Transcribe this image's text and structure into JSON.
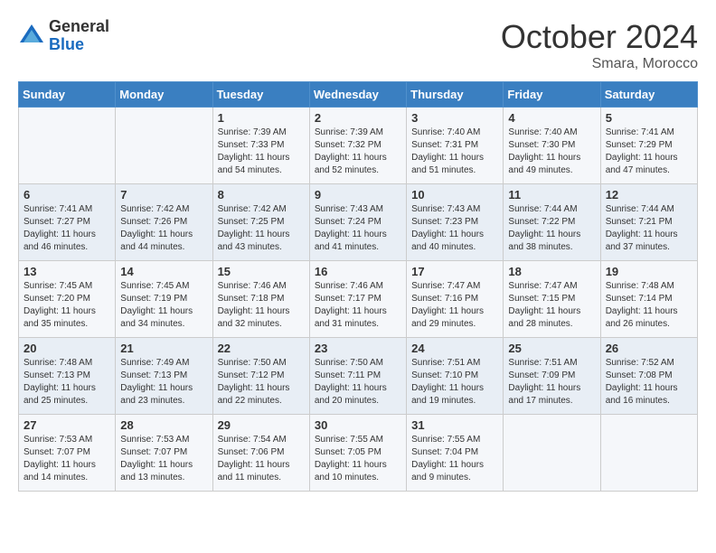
{
  "header": {
    "logo_line1": "General",
    "logo_line2": "Blue",
    "month_title": "October 2024",
    "location": "Smara, Morocco"
  },
  "days_of_week": [
    "Sunday",
    "Monday",
    "Tuesday",
    "Wednesday",
    "Thursday",
    "Friday",
    "Saturday"
  ],
  "weeks": [
    [
      {
        "day": "",
        "info": ""
      },
      {
        "day": "",
        "info": ""
      },
      {
        "day": "1",
        "info": "Sunrise: 7:39 AM\nSunset: 7:33 PM\nDaylight: 11 hours\nand 54 minutes."
      },
      {
        "day": "2",
        "info": "Sunrise: 7:39 AM\nSunset: 7:32 PM\nDaylight: 11 hours\nand 52 minutes."
      },
      {
        "day": "3",
        "info": "Sunrise: 7:40 AM\nSunset: 7:31 PM\nDaylight: 11 hours\nand 51 minutes."
      },
      {
        "day": "4",
        "info": "Sunrise: 7:40 AM\nSunset: 7:30 PM\nDaylight: 11 hours\nand 49 minutes."
      },
      {
        "day": "5",
        "info": "Sunrise: 7:41 AM\nSunset: 7:29 PM\nDaylight: 11 hours\nand 47 minutes."
      }
    ],
    [
      {
        "day": "6",
        "info": "Sunrise: 7:41 AM\nSunset: 7:27 PM\nDaylight: 11 hours\nand 46 minutes."
      },
      {
        "day": "7",
        "info": "Sunrise: 7:42 AM\nSunset: 7:26 PM\nDaylight: 11 hours\nand 44 minutes."
      },
      {
        "day": "8",
        "info": "Sunrise: 7:42 AM\nSunset: 7:25 PM\nDaylight: 11 hours\nand 43 minutes."
      },
      {
        "day": "9",
        "info": "Sunrise: 7:43 AM\nSunset: 7:24 PM\nDaylight: 11 hours\nand 41 minutes."
      },
      {
        "day": "10",
        "info": "Sunrise: 7:43 AM\nSunset: 7:23 PM\nDaylight: 11 hours\nand 40 minutes."
      },
      {
        "day": "11",
        "info": "Sunrise: 7:44 AM\nSunset: 7:22 PM\nDaylight: 11 hours\nand 38 minutes."
      },
      {
        "day": "12",
        "info": "Sunrise: 7:44 AM\nSunset: 7:21 PM\nDaylight: 11 hours\nand 37 minutes."
      }
    ],
    [
      {
        "day": "13",
        "info": "Sunrise: 7:45 AM\nSunset: 7:20 PM\nDaylight: 11 hours\nand 35 minutes."
      },
      {
        "day": "14",
        "info": "Sunrise: 7:45 AM\nSunset: 7:19 PM\nDaylight: 11 hours\nand 34 minutes."
      },
      {
        "day": "15",
        "info": "Sunrise: 7:46 AM\nSunset: 7:18 PM\nDaylight: 11 hours\nand 32 minutes."
      },
      {
        "day": "16",
        "info": "Sunrise: 7:46 AM\nSunset: 7:17 PM\nDaylight: 11 hours\nand 31 minutes."
      },
      {
        "day": "17",
        "info": "Sunrise: 7:47 AM\nSunset: 7:16 PM\nDaylight: 11 hours\nand 29 minutes."
      },
      {
        "day": "18",
        "info": "Sunrise: 7:47 AM\nSunset: 7:15 PM\nDaylight: 11 hours\nand 28 minutes."
      },
      {
        "day": "19",
        "info": "Sunrise: 7:48 AM\nSunset: 7:14 PM\nDaylight: 11 hours\nand 26 minutes."
      }
    ],
    [
      {
        "day": "20",
        "info": "Sunrise: 7:48 AM\nSunset: 7:13 PM\nDaylight: 11 hours\nand 25 minutes."
      },
      {
        "day": "21",
        "info": "Sunrise: 7:49 AM\nSunset: 7:13 PM\nDaylight: 11 hours\nand 23 minutes."
      },
      {
        "day": "22",
        "info": "Sunrise: 7:50 AM\nSunset: 7:12 PM\nDaylight: 11 hours\nand 22 minutes."
      },
      {
        "day": "23",
        "info": "Sunrise: 7:50 AM\nSunset: 7:11 PM\nDaylight: 11 hours\nand 20 minutes."
      },
      {
        "day": "24",
        "info": "Sunrise: 7:51 AM\nSunset: 7:10 PM\nDaylight: 11 hours\nand 19 minutes."
      },
      {
        "day": "25",
        "info": "Sunrise: 7:51 AM\nSunset: 7:09 PM\nDaylight: 11 hours\nand 17 minutes."
      },
      {
        "day": "26",
        "info": "Sunrise: 7:52 AM\nSunset: 7:08 PM\nDaylight: 11 hours\nand 16 minutes."
      }
    ],
    [
      {
        "day": "27",
        "info": "Sunrise: 7:53 AM\nSunset: 7:07 PM\nDaylight: 11 hours\nand 14 minutes."
      },
      {
        "day": "28",
        "info": "Sunrise: 7:53 AM\nSunset: 7:07 PM\nDaylight: 11 hours\nand 13 minutes."
      },
      {
        "day": "29",
        "info": "Sunrise: 7:54 AM\nSunset: 7:06 PM\nDaylight: 11 hours\nand 11 minutes."
      },
      {
        "day": "30",
        "info": "Sunrise: 7:55 AM\nSunset: 7:05 PM\nDaylight: 11 hours\nand 10 minutes."
      },
      {
        "day": "31",
        "info": "Sunrise: 7:55 AM\nSunset: 7:04 PM\nDaylight: 11 hours\nand 9 minutes."
      },
      {
        "day": "",
        "info": ""
      },
      {
        "day": "",
        "info": ""
      }
    ]
  ]
}
